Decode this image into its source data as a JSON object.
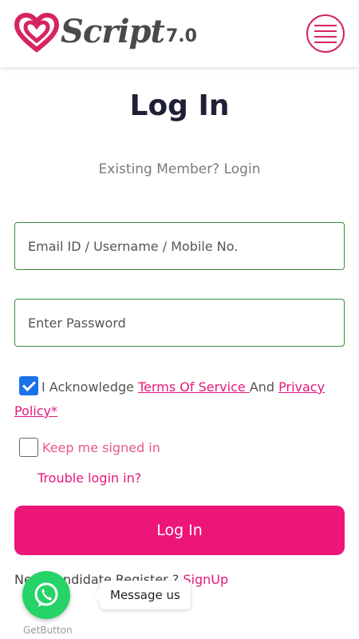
{
  "header": {
    "logo_text": "Script",
    "logo_version": "7.0",
    "menu_icon": "hamburger-menu-icon"
  },
  "main": {
    "title": "Log In",
    "subtitle": "Existing Member? Login",
    "email_placeholder": "Email ID / Username / Mobile No.",
    "password_placeholder": "Enter Password",
    "ack_prefix": "I Acknowledge ",
    "terms_link": "Terms Of Service ",
    "and_text": "And ",
    "privacy_link": "Privacy Policy*",
    "ack_checked": true,
    "keep_label": "Keep me signed in",
    "keep_checked": false,
    "trouble_link": "Trouble login in?",
    "login_button": "Log In",
    "register_prefix": "New Candidate Register ? ",
    "signup_link": "SignUp"
  },
  "widget": {
    "message_label": "Message us",
    "brand_label": "GetButton",
    "icon": "whatsapp-icon"
  },
  "colors": {
    "accent_pink": "#ec1679",
    "field_border": "#3a8a3a",
    "whatsapp_green": "#25d366",
    "title_color": "#1f2038"
  }
}
